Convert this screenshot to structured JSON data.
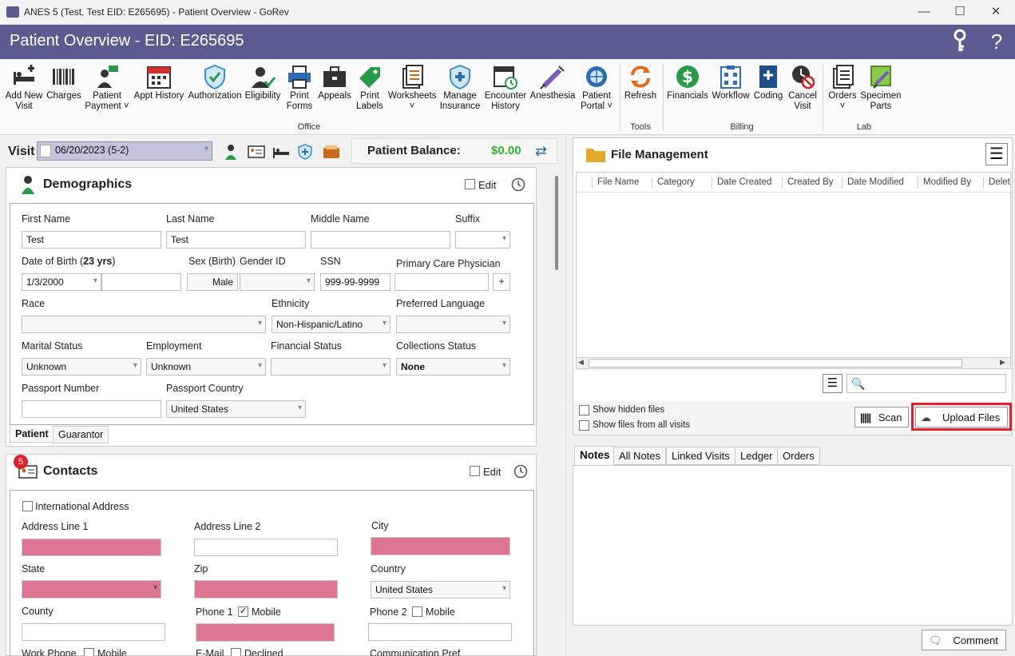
{
  "window": {
    "title": "ANES 5 (Test, Test EID: E265695) - Patient Overview - GoRev",
    "app_icon_text": "GoRev",
    "minimize": "—",
    "maximize": "☐",
    "close": "✕"
  },
  "header": {
    "title": "Patient Overview - EID: E265695"
  },
  "ribbon": {
    "office": [
      {
        "line1": "Add New",
        "line2": "Visit"
      },
      {
        "line1": "Charges",
        "line2": ""
      },
      {
        "line1": "Patient",
        "line2": "Payment ˅"
      },
      {
        "line1": "Appt History",
        "line2": ""
      },
      {
        "line1": "Authorization",
        "line2": ""
      },
      {
        "line1": "Eligibility",
        "line2": ""
      },
      {
        "line1": "Print",
        "line2": "Forms"
      },
      {
        "line1": "Appeals",
        "line2": ""
      },
      {
        "line1": "Print",
        "line2": "Labels"
      },
      {
        "line1": "Worksheets",
        "line2": "˅"
      },
      {
        "line1": "Manage",
        "line2": "Insurance"
      },
      {
        "line1": "Encounter",
        "line2": "History"
      },
      {
        "line1": "Anesthesia",
        "line2": ""
      },
      {
        "line1": "Patient",
        "line2": "Portal ˅"
      }
    ],
    "tools": [
      {
        "line1": "Refresh",
        "line2": ""
      }
    ],
    "billing": [
      {
        "line1": "Financials",
        "line2": ""
      },
      {
        "line1": "Workflow",
        "line2": ""
      },
      {
        "line1": "Coding",
        "line2": ""
      },
      {
        "line1": "Cancel",
        "line2": "Visit"
      }
    ],
    "lab": [
      {
        "line1": "Orders",
        "line2": "˅"
      },
      {
        "line1": "Specimen",
        "line2": "Parts"
      }
    ],
    "groups": {
      "office": "Office",
      "tools": "Tools",
      "billing": "Billing",
      "lab": "Lab"
    }
  },
  "visit": {
    "label": "Visit",
    "value": "06/20/2023 (5-2)",
    "balance_label": "Patient Balance:",
    "balance_value": "$0.00"
  },
  "demographics": {
    "title": "Demographics",
    "edit": "Edit",
    "first_name_label": "First Name",
    "first_name": "Test",
    "last_name_label": "Last Name",
    "last_name": "Test",
    "middle_name_label": "Middle Name",
    "suffix_label": "Suffix",
    "dob_label_pre": "Date of Birth (",
    "dob_age": "23 yrs",
    "dob_label_post": ")",
    "dob": "1/3/2000",
    "sex_label": "Sex (Birth)",
    "sex": "Male",
    "gender_label": "Gender ID",
    "ssn_label": "SSN",
    "ssn": "999-99-9999",
    "pcp_label": "Primary Care Physician",
    "pcp_add": "+",
    "race_label": "Race",
    "ethnicity_label": "Ethnicity",
    "ethnicity": "Non-Hispanic/Latino",
    "language_label": "Preferred Language",
    "marital_label": "Marital Status",
    "marital": "Unknown",
    "employment_label": "Employment",
    "employment": "Unknown",
    "financial_label": "Financial Status",
    "collections_label": "Collections Status",
    "collections": "None",
    "passport_label": "Passport Number",
    "passport_country_label": "Passport Country",
    "passport_country": "United States",
    "tabs": [
      "Patient",
      "Guarantor"
    ]
  },
  "contacts": {
    "title": "Contacts",
    "badge": "5",
    "edit": "Edit",
    "intl": "International Address",
    "addr1": "Address Line 1",
    "addr2": "Address Line 2",
    "city": "City",
    "state": "State",
    "zip": "Zip",
    "country_label": "Country",
    "country": "United States",
    "county": "County",
    "phone1": "Phone 1",
    "mobile": "Mobile",
    "phone2": "Phone 2",
    "work_phone": "Work Phone",
    "email": "E-Mail",
    "declined": "Declined",
    "comm_pref": "Communication Pref"
  },
  "files": {
    "title": "File Management",
    "columns": [
      "File Name",
      "Category",
      "Date Created",
      "Created By",
      "Date Modified",
      "Modified By",
      "Delet"
    ],
    "show_hidden": "Show hidden files",
    "show_all": "Show files from all visits",
    "scan": "Scan",
    "upload": "Upload Files"
  },
  "notes": {
    "tabs": [
      "Notes",
      "All Notes",
      "Linked Visits",
      "Ledger",
      "Orders"
    ],
    "comment": "Comment"
  },
  "colors": {
    "header": "#5b5a91",
    "required": "#de7593",
    "balance": "#2db52d",
    "highlight": "#e0202a"
  }
}
